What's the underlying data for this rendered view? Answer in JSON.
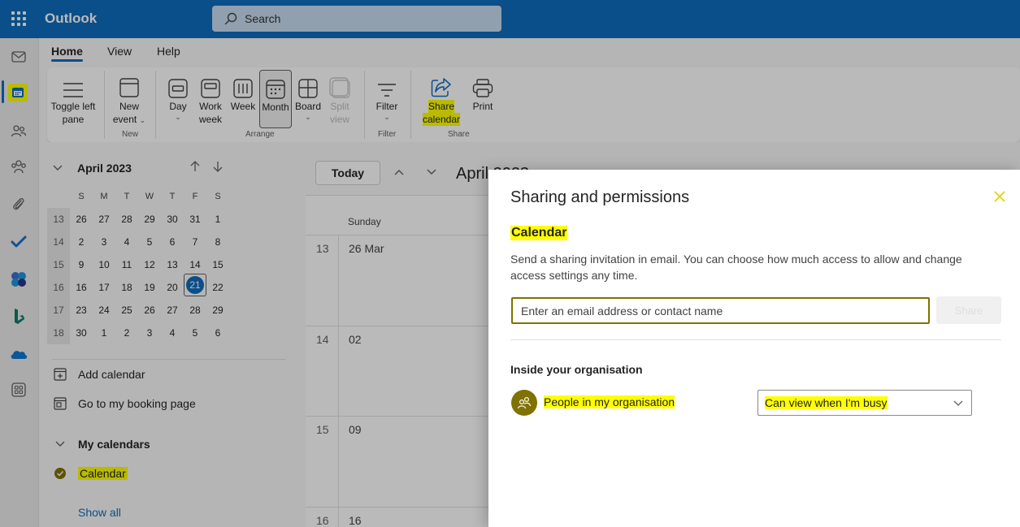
{
  "app": {
    "title": "Outlook"
  },
  "search": {
    "placeholder": "Search"
  },
  "ribbon": {
    "tabs": [
      "Home",
      "View",
      "Help"
    ],
    "buttons": {
      "toggle_pane": [
        "Toggle left",
        "pane"
      ],
      "new_event": [
        "New",
        "event"
      ],
      "day": "Day",
      "work_week": [
        "Work",
        "week"
      ],
      "week": "Week",
      "month": "Month",
      "board": "Board",
      "split_view": [
        "Split",
        "view"
      ],
      "filter": "Filter",
      "share_calendar": [
        "Share",
        "calendar"
      ],
      "print": "Print"
    },
    "groups": {
      "new": "New",
      "arrange": "Arrange",
      "filter": "Filter",
      "share": "Share"
    }
  },
  "mini_calendar": {
    "month_label": "April 2023",
    "weekdays": [
      "S",
      "M",
      "T",
      "W",
      "T",
      "F",
      "S"
    ],
    "weeks": [
      {
        "num": "13",
        "days": [
          "26",
          "27",
          "28",
          "29",
          "30",
          "31",
          "1"
        ]
      },
      {
        "num": "14",
        "days": [
          "2",
          "3",
          "4",
          "5",
          "6",
          "7",
          "8"
        ]
      },
      {
        "num": "15",
        "days": [
          "9",
          "10",
          "11",
          "12",
          "13",
          "14",
          "15"
        ]
      },
      {
        "num": "16",
        "days": [
          "16",
          "17",
          "18",
          "19",
          "20",
          "21",
          "22"
        ]
      },
      {
        "num": "17",
        "days": [
          "23",
          "24",
          "25",
          "26",
          "27",
          "28",
          "29"
        ]
      },
      {
        "num": "18",
        "days": [
          "30",
          "1",
          "2",
          "3",
          "4",
          "5",
          "6"
        ]
      }
    ],
    "today": "21"
  },
  "sidebar": {
    "add_calendar": "Add calendar",
    "booking_page": "Go to my booking page",
    "my_calendars": "My calendars",
    "calendar": "Calendar",
    "show_all": "Show all"
  },
  "calendar_view": {
    "today_button": "Today",
    "title": "April 2023",
    "weekday": "Sunday",
    "rows": [
      {
        "week": "13",
        "day": "26 Mar"
      },
      {
        "week": "14",
        "day": "02"
      },
      {
        "week": "15",
        "day": "09"
      },
      {
        "week": "16",
        "day": "16"
      }
    ]
  },
  "dialog": {
    "title": "Sharing and permissions",
    "subtitle": "Calendar",
    "description": "Send a sharing invitation in email. You can choose how much access to allow and change access settings any time.",
    "email_placeholder": "Enter an email address or contact name",
    "share_button": "Share",
    "inside_org_label": "Inside your organisation",
    "org_name": "People in my organisation",
    "permission": "Can view when I'm busy"
  },
  "colors": {
    "brand": "#0f6cbd",
    "highlight": "#ffff00",
    "org_avatar": "#7f7200"
  }
}
